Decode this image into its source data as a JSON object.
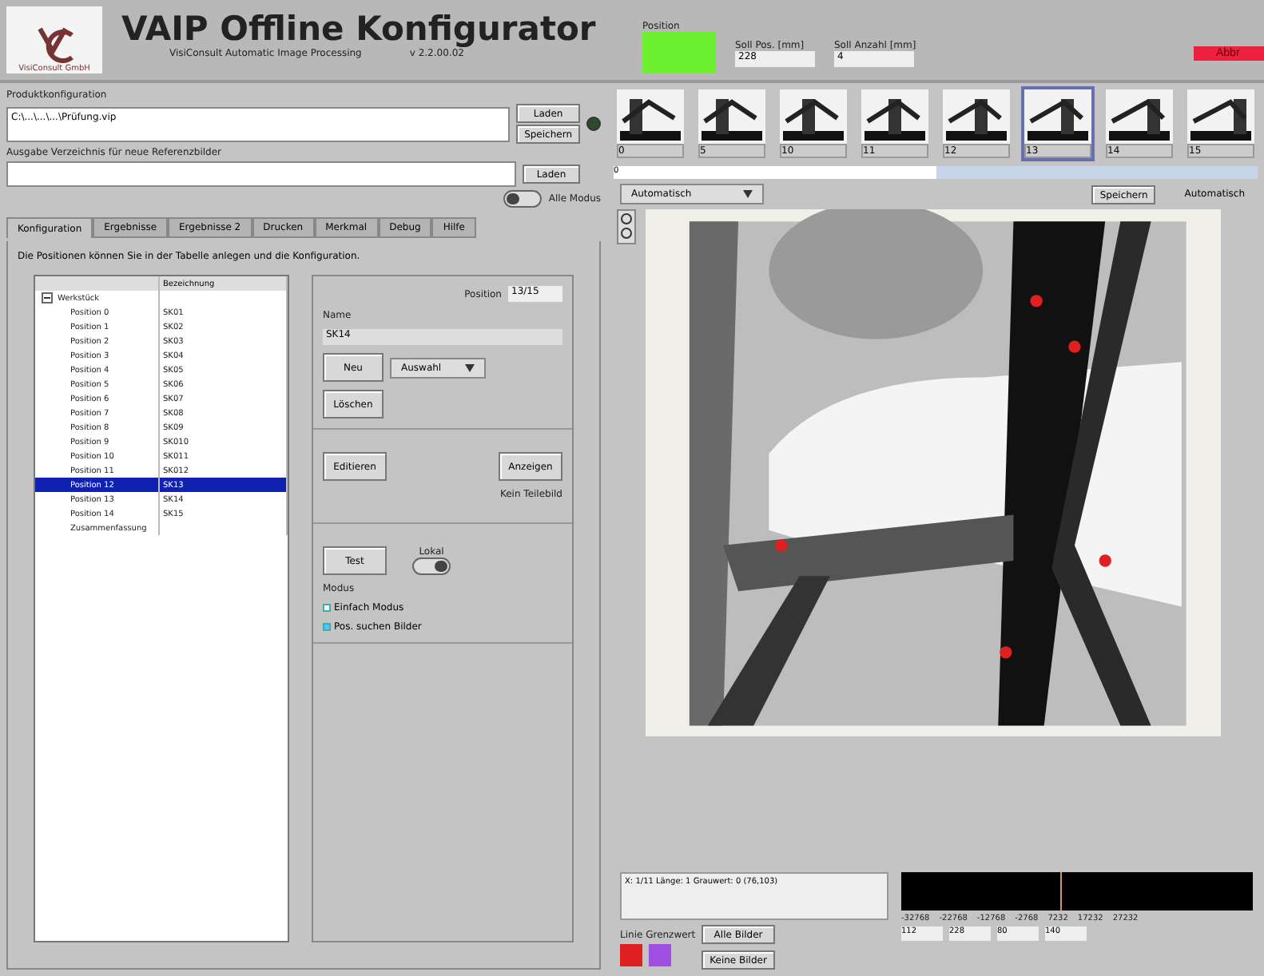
{
  "header": {
    "title": "VAIP Offline Konfigurator",
    "subtitle": "VisiConsult Automatic Image Processing",
    "version": "v 2.2.00.02",
    "logo_text": "VisiConsult GmbH"
  },
  "status": {
    "label": "Position",
    "ok": true,
    "fields": [
      {
        "label": "Soll Pos. [mm]",
        "value": "228"
      },
      {
        "label": "Soll Anzahl [mm]",
        "value": "4"
      }
    ],
    "alarm_button": "Abbr"
  },
  "config": {
    "label": "Produktkonfiguration",
    "value": "C:\\...\\...\\...\\Prüfung.vip",
    "buttons": [
      "Laden",
      "Speichern"
    ],
    "led_on": false
  },
  "output": {
    "label": "Ausgabe Verzeichnis für neue Referenzbilder",
    "button": "Laden",
    "toggle_label": "Alle Modus",
    "toggle_on": false
  },
  "tabs": [
    {
      "label": "Konfiguration",
      "selected": true
    },
    {
      "label": "Ergebnisse",
      "selected": false
    },
    {
      "label": "Ergebnisse 2",
      "selected": false
    },
    {
      "label": "Drucken",
      "selected": false
    },
    {
      "label": "Merkmal",
      "selected": false
    },
    {
      "label": "Debug",
      "selected": false
    },
    {
      "label": "Hilfe",
      "selected": false
    }
  ],
  "hint": "Die Positionen können Sie in der Tabelle anlegen und die Konfiguration.",
  "tree": {
    "columns": [
      "",
      "Bezeichnung"
    ],
    "root": {
      "label": "Werkstück",
      "expanded": true,
      "children": [
        {
          "label": "Position 0",
          "value": "SK01",
          "selected": false
        },
        {
          "label": "Position 1",
          "value": "SK02",
          "selected": false
        },
        {
          "label": "Position 2",
          "value": "SK03",
          "selected": false
        },
        {
          "label": "Position 3",
          "value": "SK04",
          "selected": false
        },
        {
          "label": "Position 4",
          "value": "SK05",
          "selected": false
        },
        {
          "label": "Position 5",
          "value": "SK06",
          "selected": false
        },
        {
          "label": "Position 6",
          "value": "SK07",
          "selected": false
        },
        {
          "label": "Position 7",
          "value": "SK08",
          "selected": false
        },
        {
          "label": "Position 8",
          "value": "SK09",
          "selected": false
        },
        {
          "label": "Position 9",
          "value": "SK010",
          "selected": false
        },
        {
          "label": "Position 10",
          "value": "SK011",
          "selected": false
        },
        {
          "label": "Position 11",
          "value": "SK012",
          "selected": false
        },
        {
          "label": "Position 12",
          "value": "SK13",
          "selected": true
        },
        {
          "label": "Position 13",
          "value": "SK14",
          "selected": false
        },
        {
          "label": "Position 14",
          "value": "SK15",
          "selected": false
        },
        {
          "label": "Zusammenfassung",
          "selected": false
        }
      ]
    }
  },
  "editor": {
    "position_label": "Position",
    "position_value": "13/15",
    "name_label": "Name",
    "name_value": "SK14",
    "new_button": "Neu",
    "delete_button": "Löschen",
    "select": "Auswahl",
    "edit_button": "Editieren",
    "show_button": "Anzeigen",
    "show_caption": "Kein Teilebild",
    "test_button": "Test",
    "switch_label": "Lokal",
    "switch_on": true,
    "mode_label": "Modus",
    "modes": [
      {
        "label": "Einfach Modus",
        "selected": false
      },
      {
        "label": "Pos. suchen Bilder",
        "selected": true
      }
    ]
  },
  "thumbnails": [
    {
      "label": "0",
      "selected": false
    },
    {
      "label": "5",
      "selected": false
    },
    {
      "label": "10",
      "selected": false
    },
    {
      "label": "11",
      "selected": false
    },
    {
      "label": "12",
      "selected": false
    },
    {
      "label": "13",
      "selected": true
    },
    {
      "label": "14",
      "selected": false
    },
    {
      "label": "15",
      "selected": false
    }
  ],
  "progress": {
    "label": "0",
    "level": 0.5
  },
  "view": {
    "mode_select": "Automatisch",
    "save_button": "Speichern",
    "auto_button": "Automatisch"
  },
  "readout": "X: 1/11 Länge: 1 Grauwert: 0 (76,103)",
  "legend": {
    "label": "Linie Grenzwert",
    "colors": [
      {
        "color": "#e02020"
      },
      {
        "color": "#a050e0"
      }
    ]
  },
  "legend_buttons": [
    "Alle Bilder",
    "Keine Bilder"
  ],
  "histogram_ticks": [
    "-32768",
    "-22768",
    "-12768",
    "-2768",
    "7232",
    "17232",
    "27232"
  ],
  "histogram_fields": [
    "112",
    "228",
    "80",
    "140"
  ]
}
